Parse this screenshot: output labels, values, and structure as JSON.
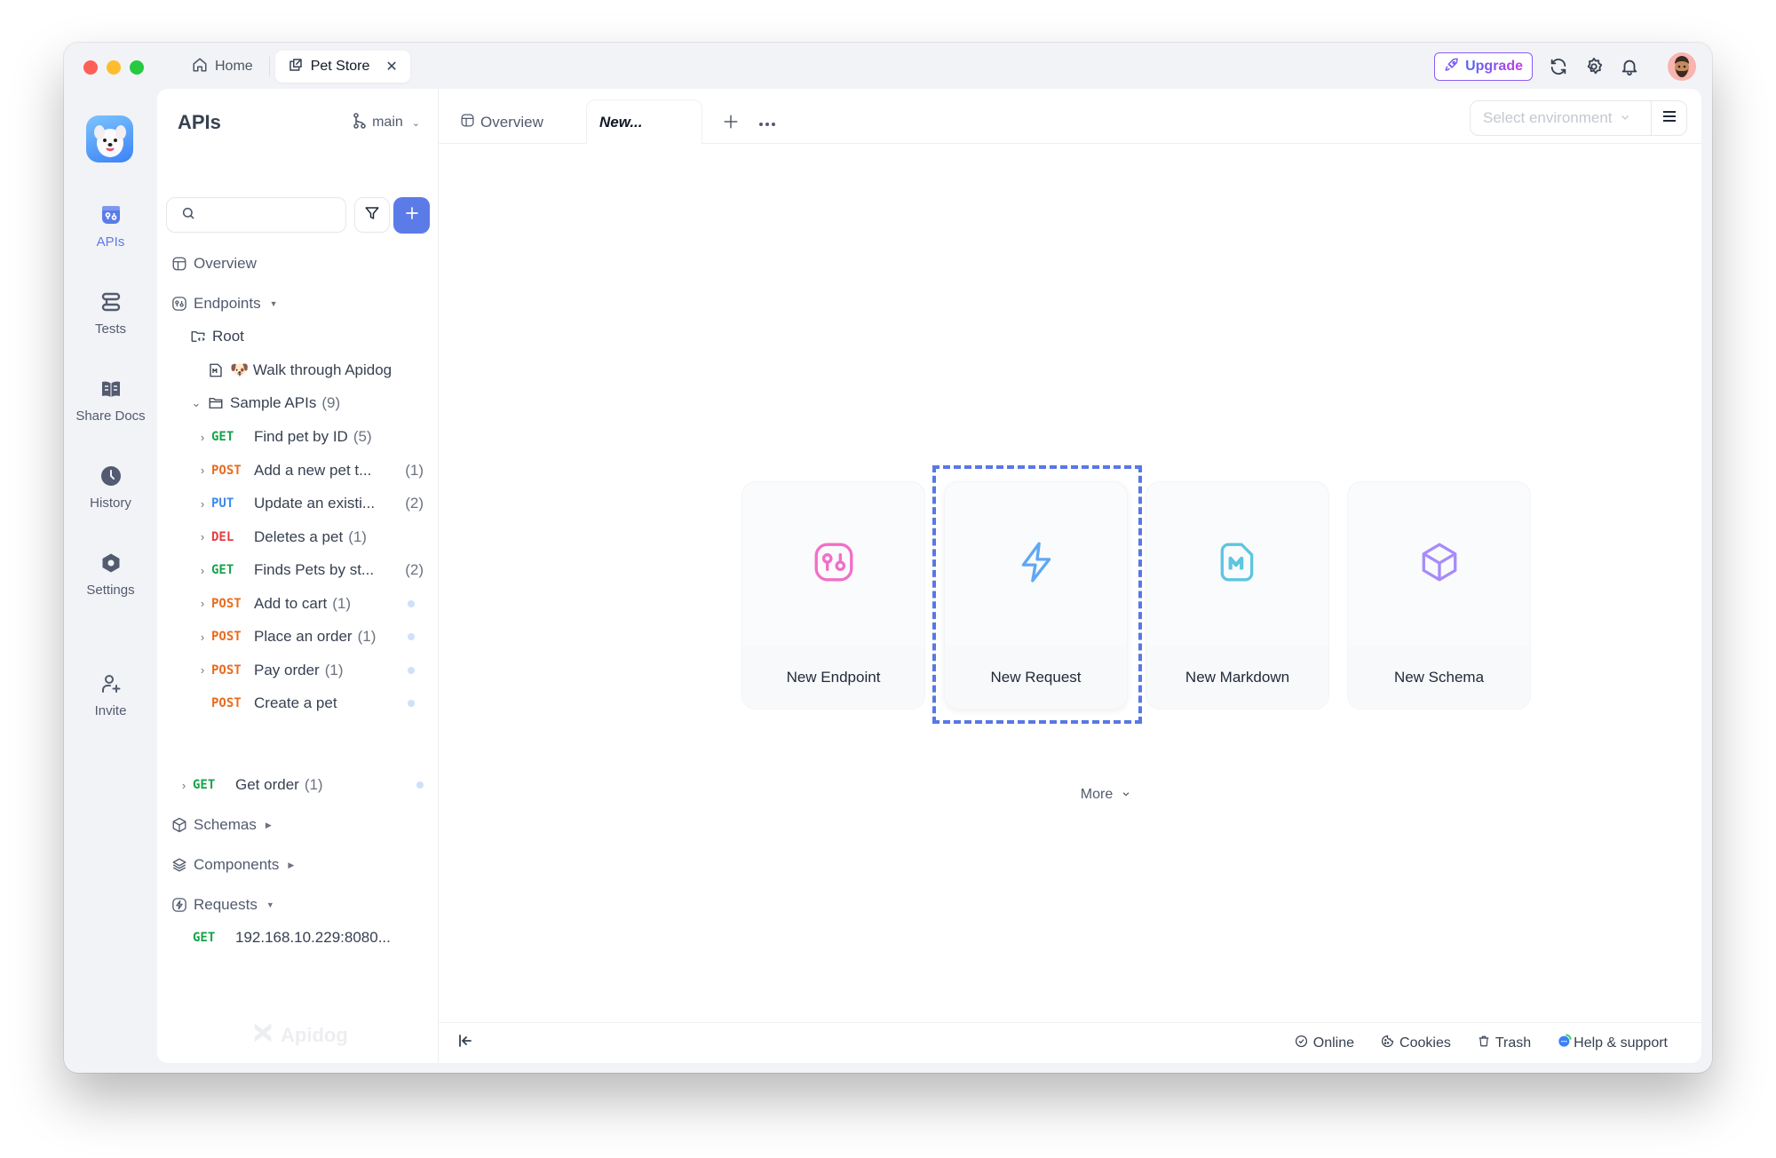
{
  "window": {
    "top_tabs": [
      {
        "label": "Home",
        "icon": "home-icon"
      },
      {
        "label": "Pet Store",
        "icon": "external-link-icon",
        "close": "✕"
      }
    ],
    "upgrade_label": "Upgrade",
    "top_icons": [
      "sync-icon",
      "settings-gear-icon",
      "bell-icon",
      "avatar"
    ]
  },
  "rail": {
    "items": [
      {
        "label": "APIs",
        "icon": "apis-icon",
        "active": true
      },
      {
        "label": "Tests",
        "icon": "tests-icon"
      },
      {
        "label": "Share Docs",
        "icon": "book-icon"
      },
      {
        "label": "History",
        "icon": "clock-icon"
      },
      {
        "label": "Settings",
        "icon": "hexagon-settings-icon"
      },
      {
        "label": "Invite",
        "icon": "user-plus-icon"
      }
    ]
  },
  "sidebar": {
    "title": "APIs",
    "branch": "main",
    "search_placeholder": "",
    "tree": {
      "overview": "Overview",
      "endpoints": "Endpoints",
      "root": "Root",
      "walkthrough": "🐶 Walk through Apidog",
      "sample_apis": "Sample APIs",
      "sample_apis_count": "(9)",
      "items": [
        {
          "method": "GET",
          "name": "Find pet by ID",
          "count": "(5)",
          "expandable": true,
          "dot": false
        },
        {
          "method": "POST",
          "name": "Add a new pet t...",
          "count": "(1)",
          "expandable": true,
          "dot": false
        },
        {
          "method": "PUT",
          "name": "Update an existi...",
          "count": "(2)",
          "expandable": true,
          "dot": false
        },
        {
          "method": "DEL",
          "name": "Deletes a pet",
          "count": "(1)",
          "expandable": true,
          "dot": false
        },
        {
          "method": "GET",
          "name": "Finds Pets by st...",
          "count": "(2)",
          "expandable": true,
          "dot": false
        },
        {
          "method": "POST",
          "name": "Add to cart",
          "count": "(1)",
          "expandable": true,
          "dot": true
        },
        {
          "method": "POST",
          "name": "Place an order",
          "count": "(1)",
          "expandable": true,
          "dot": true
        },
        {
          "method": "POST",
          "name": "Pay order",
          "count": "(1)",
          "expandable": true,
          "dot": true
        },
        {
          "method": "POST",
          "name": "Create a pet",
          "count": "",
          "expandable": false,
          "dot": true
        }
      ],
      "get_order": {
        "method": "GET",
        "name": "Get order",
        "count": "(1)"
      },
      "schemas": "Schemas",
      "components": "Components",
      "requests": "Requests",
      "request_item": {
        "method": "GET",
        "name": "192.168.10.229:8080..."
      }
    },
    "watermark": "Apidog"
  },
  "main": {
    "tabs": [
      {
        "label": "Overview"
      },
      {
        "label": "New..."
      }
    ],
    "env_placeholder": "Select environment",
    "cards": [
      {
        "label": "New Endpoint",
        "icon": "endpoint-icon",
        "color": "#f06fc8"
      },
      {
        "label": "New Request",
        "icon": "lightning-icon",
        "color": "#5ea8f5"
      },
      {
        "label": "New Markdown",
        "icon": "markdown-icon",
        "color": "#5cc6e0"
      },
      {
        "label": "New Schema",
        "icon": "cube-icon",
        "color": "#a78bfa"
      }
    ],
    "more_label": "More"
  },
  "footer": {
    "items": [
      {
        "label": "Online",
        "icon": "check-circle-icon"
      },
      {
        "label": "Cookies",
        "icon": "cookie-icon"
      },
      {
        "label": "Trash",
        "icon": "trash-icon"
      },
      {
        "label": "Help & support",
        "icon": "chat-bubble-icon"
      }
    ]
  },
  "colors": {
    "accent": "#5b7be9",
    "get": "#17a34a",
    "post": "#ea6b1f",
    "put": "#3b8beb",
    "delete": "#e53e3e"
  }
}
